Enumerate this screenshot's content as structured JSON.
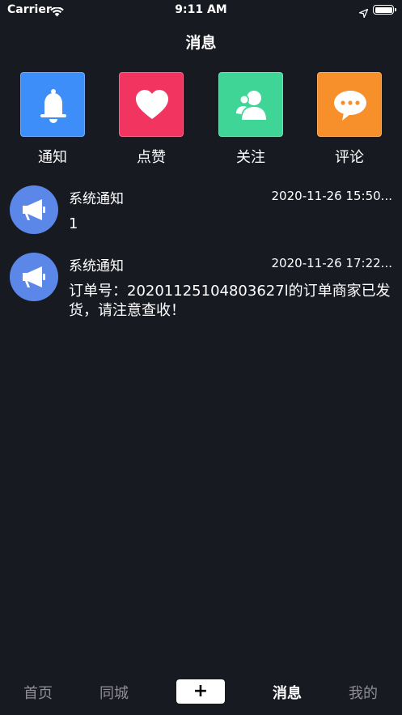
{
  "status_bar": {
    "carrier": "Carrier",
    "time": "9:11 AM",
    "wifi_icon": "wifi-icon",
    "location_icon": "location-arrow-icon",
    "battery_icon": "battery-full-icon"
  },
  "header": {
    "title": "消息"
  },
  "categories": [
    {
      "label": "通知",
      "icon": "bell-icon",
      "color": "#3d8ef8"
    },
    {
      "label": "点赞",
      "icon": "heart-icon",
      "color": "#f23461"
    },
    {
      "label": "关注",
      "icon": "users-icon",
      "color": "#3fd597"
    },
    {
      "label": "评论",
      "icon": "chat-bubble-icon",
      "color": "#f78f2b"
    }
  ],
  "messages": [
    {
      "title": "系统通知",
      "time": "2020-11-26 15:50...",
      "body": "1",
      "icon": "megaphone-icon"
    },
    {
      "title": "系统通知",
      "time": "2020-11-26 17:22...",
      "body": "订单号：20201125104803627l的订单商家已发货，请注意查收！",
      "icon": "megaphone-icon"
    }
  ],
  "tab_bar": {
    "home": "首页",
    "city": "同城",
    "add": "+",
    "messages": "消息",
    "profile": "我的",
    "active": "消息"
  }
}
